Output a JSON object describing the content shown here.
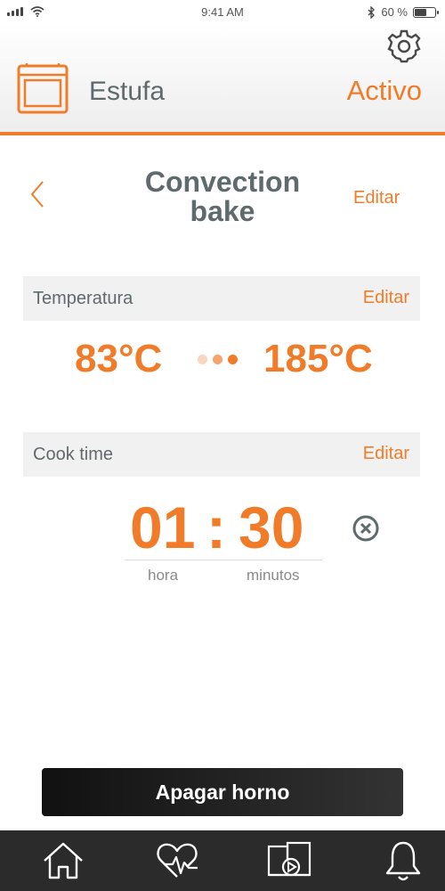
{
  "status_bar": {
    "time": "9:41 AM",
    "battery": "60 %",
    "battery_level": 0.6,
    "icons": [
      "signal-icon",
      "wifi-icon",
      "bluetooth-icon",
      "battery-icon"
    ]
  },
  "header": {
    "appliance_name": "Estufa",
    "status": "Activo",
    "icons": [
      "oven-icon",
      "gear-icon"
    ]
  },
  "mode": {
    "title_line1": "Convection",
    "title_line2": "bake",
    "edit_label": "Editar",
    "back_icon": "chevron-left-icon"
  },
  "temperature": {
    "label": "Temperatura",
    "edit_label": "Editar",
    "from": "83°C",
    "to": "185°C"
  },
  "cook_time": {
    "label": "Cook time",
    "edit_label": "Editar",
    "hours": "01",
    "separator": ":",
    "minutes": "30",
    "hours_label": "hora",
    "minutes_label": "minutos",
    "clear_icon": "clear-circle-icon"
  },
  "action": {
    "label": "Apagar horno"
  },
  "bottom_nav": {
    "items": [
      "home-icon",
      "heart-pulse-icon",
      "recipes-video-icon",
      "bell-icon"
    ]
  },
  "colors": {
    "accent": "#f07c2a",
    "text": "#5f6a6c",
    "section_bg": "#f1f1f1",
    "nav_bg": "#2b2b2b",
    "dot_faint": "#f9d6c0",
    "dot_mid": "#f5a46e"
  }
}
